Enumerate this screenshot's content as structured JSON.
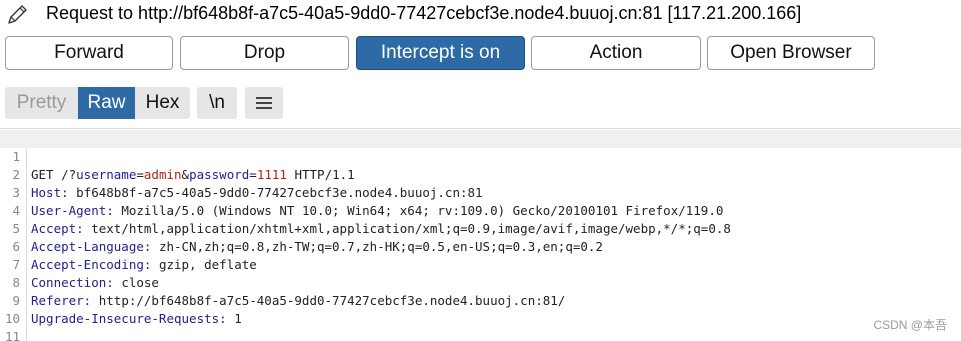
{
  "header": {
    "title": "Request to http://bf648b8f-a7c5-40a5-9dd0-77427cebcf3e.node4.buuoj.cn:81  [117.21.200.166]"
  },
  "toolbar": {
    "forward": "Forward",
    "drop": "Drop",
    "intercept": "Intercept is on",
    "action": "Action",
    "open_browser": "Open Browser"
  },
  "view_tabs": {
    "pretty": "Pretty",
    "raw": "Raw",
    "hex": "Hex",
    "newline": "\\n"
  },
  "request": {
    "line_numbers": [
      "1",
      "2",
      "3",
      "4",
      "5",
      "6",
      "7",
      "8",
      "9",
      "10",
      "11"
    ],
    "line1": {
      "method_path": "GET /?",
      "p1_name": "username",
      "eq": "=",
      "p1_value": "admin",
      "amp": "&",
      "p2_name": "password",
      "p2_value": "1111",
      "version": " HTTP/1.1"
    },
    "headers": [
      {
        "name": "Host:",
        "value": " bf648b8f-a7c5-40a5-9dd0-77427cebcf3e.node4.buuoj.cn:81"
      },
      {
        "name": "User-Agent:",
        "value": " Mozilla/5.0 (Windows NT 10.0; Win64; x64; rv:109.0) Gecko/20100101 Firefox/119.0"
      },
      {
        "name": "Accept:",
        "value": " text/html,application/xhtml+xml,application/xml;q=0.9,image/avif,image/webp,*/*;q=0.8"
      },
      {
        "name": "Accept-Language:",
        "value": " zh-CN,zh;q=0.8,zh-TW;q=0.7,zh-HK;q=0.5,en-US;q=0.3,en;q=0.2"
      },
      {
        "name": "Accept-Encoding:",
        "value": " gzip, deflate"
      },
      {
        "name": "Connection:",
        "value": " close"
      },
      {
        "name": "Referer:",
        "value": " http://bf648b8f-a7c5-40a5-9dd0-77427cebcf3e.node4.buuoj.cn:81/"
      },
      {
        "name": "Upgrade-Insecure-Requests:",
        "value": " 1"
      }
    ]
  },
  "watermark": "CSDN @本吾",
  "colors": {
    "accent": "#2e6aa5",
    "header_name": "#22228a",
    "param_value": "#b22222"
  },
  "icons": {
    "title": "pencil-icon",
    "menu": "hamburger-menu-icon"
  }
}
